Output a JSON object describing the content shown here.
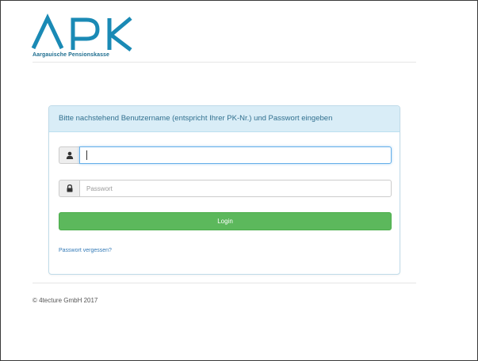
{
  "brand": {
    "logo_text": "APK",
    "name": "Aargauische Pensionskasse",
    "color": "#1a8ab5"
  },
  "panel": {
    "heading": "Bitte nachstehend Benutzername (entspricht Ihrer PK-Nr.) und Passwort eingeben"
  },
  "form": {
    "username": {
      "icon": "user-icon",
      "value": "",
      "placeholder": "",
      "focused": true
    },
    "password": {
      "icon": "lock-icon",
      "value": "",
      "placeholder": "Passwort"
    },
    "login_label": "Login",
    "forgot_label": "Passwort vergessen?"
  },
  "footer": {
    "copyright": "© 4tecture GmbH 2017"
  },
  "colors": {
    "heading_bg": "#d9edf7",
    "heading_text": "#31708f",
    "button_bg": "#5cb85c",
    "link": "#337ab7"
  }
}
